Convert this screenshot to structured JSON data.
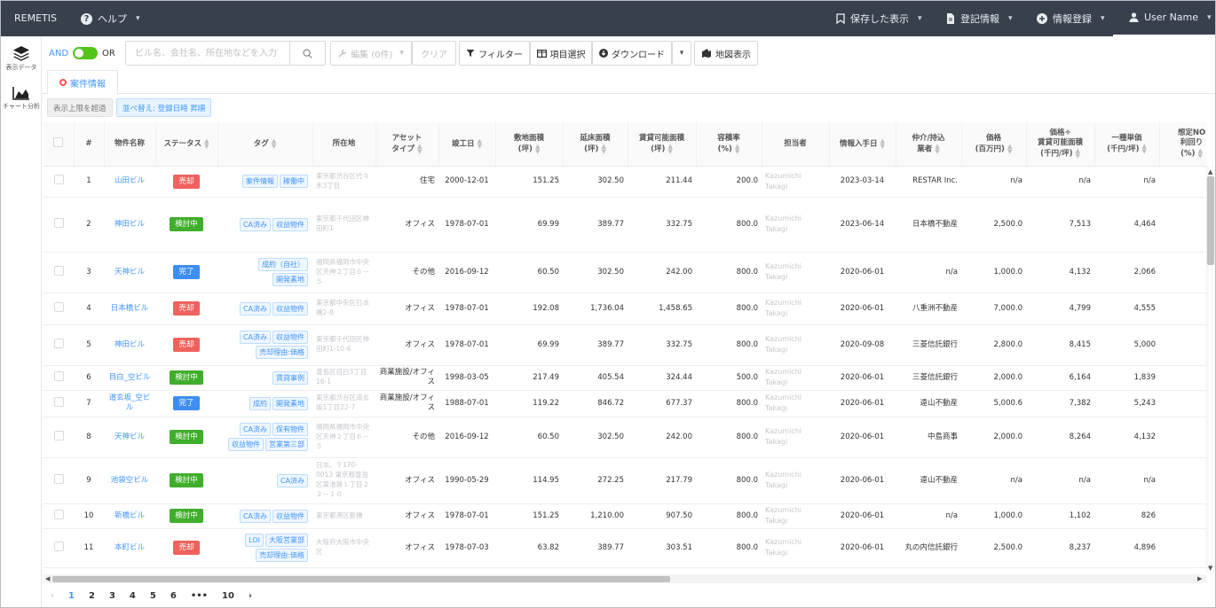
{
  "navbar": {
    "brand": "REMETIS",
    "help": "ヘルプ",
    "saved_views": "保存した表示",
    "registry": "登記情報",
    "info_register": "情報登録",
    "user": "User Name"
  },
  "sidebar": {
    "items": [
      {
        "label": "表示データ",
        "icon": "layers-icon"
      },
      {
        "label": "チャート分析",
        "icon": "area-chart-icon"
      }
    ]
  },
  "toolbar": {
    "and_label": "AND",
    "or_label": "OR",
    "search_placeholder": "ビル名、会社名、所在地などを入力",
    "edit": "編集 (0件)",
    "clear": "クリア",
    "filter": "フィルター",
    "columns": "項目選択",
    "download": "ダウンロード",
    "map": "地図表示"
  },
  "tab": {
    "label": "案件情報"
  },
  "chips": {
    "over_limit": "表示上限を超過",
    "sort": "並べ替え: 登録日時 昇順"
  },
  "colors": {
    "accent": "#4096ff",
    "navbar": "#38404c",
    "sold": "#f0625d",
    "reviewing": "#3fae2a",
    "done": "#3d8ef0"
  },
  "table": {
    "headers": [
      "#",
      "物件名称",
      "ステータス",
      "タグ",
      "所在地",
      "アセット\nタイプ",
      "竣工日",
      "敷地面積\n(坪)",
      "延床面積\n(坪)",
      "賃貸可能面積\n(坪)",
      "容積率\n(%)",
      "担当者",
      "情報入手日",
      "仲介/持込\n業者",
      "価格\n(百万円)",
      "価格÷\n賃貸可能面積\n(千円/坪)",
      "一種単価\n(千円/坪)",
      "想定NO\n利回り\n(%)"
    ],
    "rows": [
      {
        "no": "1",
        "name": "山田ビル",
        "status": "売却",
        "tags": [
          "案件情報",
          "稼働中"
        ],
        "address": "東京都渋谷区代々木3丁目",
        "asset": "住宅",
        "built": "2000-12-01",
        "site": "151.25",
        "floor": "302.50",
        "leasable": "211.44",
        "far": "200.0",
        "person": "Kazumichi Takagi",
        "acquired": "2023-03-14",
        "broker": "RESTAR Inc.",
        "price": "n/a",
        "ppa": "n/a",
        "unit": "n/a"
      },
      {
        "no": "2",
        "name": "神田ビル",
        "status": "検討中",
        "tags": [
          "CA済み",
          "収益物件"
        ],
        "address": "東京都千代田区神田町1",
        "asset": "オフィス",
        "built": "1978-07-01",
        "site": "69.99",
        "floor": "389.77",
        "leasable": "332.75",
        "far": "800.0",
        "person": "Kazumichi Takagi",
        "acquired": "2023-06-14",
        "broker": "日本橋不動産",
        "price": "2,500.0",
        "ppa": "7,513",
        "unit": "4,464"
      },
      {
        "no": "3",
        "name": "天神ビル",
        "status": "完了",
        "tags": [
          "成約（自社）",
          "開発素地"
        ],
        "address": "福岡県福岡市中央区天神２丁目６－５",
        "asset": "その他",
        "built": "2016-09-12",
        "site": "60.50",
        "floor": "302.50",
        "leasable": "242.00",
        "far": "800.0",
        "person": "Kazumichi Takagi",
        "acquired": "2020-06-01",
        "broker": "n/a",
        "price": "1,000.0",
        "ppa": "4,132",
        "unit": "2,066"
      },
      {
        "no": "4",
        "name": "日本橋ビル",
        "status": "売却",
        "tags": [
          "CA済み",
          "収益物件"
        ],
        "address": "東京都中央区日本橋2-8",
        "asset": "オフィス",
        "built": "1978-07-01",
        "site": "192.08",
        "floor": "1,736.04",
        "leasable": "1,458.65",
        "far": "800.0",
        "person": "Kazumichi Takagi",
        "acquired": "2020-06-01",
        "broker": "八重洲不動産",
        "price": "7,000.0",
        "ppa": "4,799",
        "unit": "4,555"
      },
      {
        "no": "5",
        "name": "神田ビル",
        "status": "売却",
        "tags": [
          "CA済み",
          "収益物件",
          "売却理由:価格"
        ],
        "address": "東京都千代田区神田町1-10-6",
        "asset": "オフィス",
        "built": "1978-07-01",
        "site": "69.99",
        "floor": "389.77",
        "leasable": "332.75",
        "far": "800.0",
        "person": "Kazumichi Takagi",
        "acquired": "2020-09-08",
        "broker": "三菱信託銀行",
        "price": "2,800.0",
        "ppa": "8,415",
        "unit": "5,000"
      },
      {
        "no": "6",
        "name": "目白_空ビル",
        "status": "検討中",
        "tags": [
          "賃貸事例"
        ],
        "address": "豊島区目白3丁目16-1",
        "asset": "商業施設/オフィス",
        "built": "1998-03-05",
        "site": "217.49",
        "floor": "405.54",
        "leasable": "324.44",
        "far": "500.0",
        "person": "Kazumichi Takagi",
        "acquired": "2020-06-01",
        "broker": "三菱信託銀行",
        "price": "2,000.0",
        "ppa": "6,164",
        "unit": "1,839"
      },
      {
        "no": "7",
        "name": "道玄坂_空ビル",
        "status": "完了",
        "tags": [
          "成約",
          "開発素地"
        ],
        "address": "東京都渋谷区道玄坂1丁目22-7",
        "asset": "商業施設/オフィス",
        "built": "1988-07-01",
        "site": "119.22",
        "floor": "846.72",
        "leasable": "677.37",
        "far": "800.0",
        "person": "Kazumichi Takagi",
        "acquired": "2020-06-01",
        "broker": "遠山不動産",
        "price": "5,000.6",
        "ppa": "7,382",
        "unit": "5,243"
      },
      {
        "no": "8",
        "name": "天神ビル",
        "status": "検討中",
        "tags": [
          "CA済み",
          "保有物件",
          "収益物件",
          "営業第三部"
        ],
        "address": "福岡県福岡市中央区天神２丁目６－５",
        "asset": "その他",
        "built": "2016-09-12",
        "site": "60.50",
        "floor": "302.50",
        "leasable": "242.00",
        "far": "800.0",
        "person": "Kazumichi Takagi",
        "acquired": "2020-06-01",
        "broker": "中島商事",
        "price": "2,000.0",
        "ppa": "8,264",
        "unit": "4,132"
      },
      {
        "no": "9",
        "name": "池袋空ビル",
        "status": "検討中",
        "tags": [
          "CA済み"
        ],
        "address": "日本、〒170-0013 東京都豊島区東池袋１丁目２２－１０",
        "asset": "オフィス",
        "built": "1990-05-29",
        "site": "114.95",
        "floor": "272.25",
        "leasable": "217.79",
        "far": "800.0",
        "person": "Kazumichi Takagi",
        "acquired": "2020-06-01",
        "broker": "遠山不動産",
        "price": "n/a",
        "ppa": "n/a",
        "unit": "n/a"
      },
      {
        "no": "10",
        "name": "新橋ビル",
        "status": "検討中",
        "tags": [
          "CA済み",
          "収益物件"
        ],
        "address": "東京都港区新橋",
        "asset": "オフィス",
        "built": "1978-07-01",
        "site": "151.25",
        "floor": "1,210.00",
        "leasable": "907.50",
        "far": "800.0",
        "person": "Kazumichi Takagi",
        "acquired": "2020-06-01",
        "broker": "n/a",
        "price": "1,000.0",
        "ppa": "1,102",
        "unit": "826"
      },
      {
        "no": "11",
        "name": "本町ビル",
        "status": "売却",
        "tags": [
          "LOI",
          "大阪営業部",
          "売却理由:価格"
        ],
        "address": "大阪府大阪市中央区",
        "asset": "オフィス",
        "built": "1978-07-03",
        "site": "63.82",
        "floor": "389.77",
        "leasable": "303.51",
        "far": "800.0",
        "person": "Kazumichi Takagi",
        "acquired": "2020-06-01",
        "broker": "丸の内信託銀行",
        "price": "2,500.0",
        "ppa": "8,237",
        "unit": "4,896"
      }
    ]
  },
  "pagination": {
    "pages": [
      "1",
      "2",
      "3",
      "4",
      "5",
      "6"
    ],
    "ellipsis": "•••",
    "last": "10",
    "prev": "‹",
    "next": "›"
  }
}
